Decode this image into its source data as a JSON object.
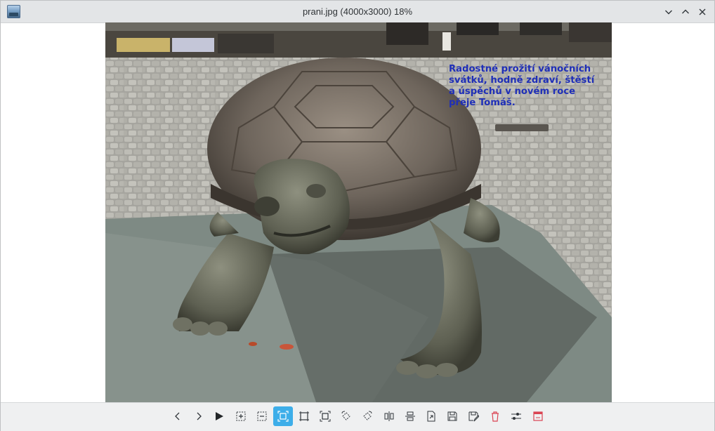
{
  "window": {
    "title": "prani.jpg (4000x3000) 18%",
    "icons": [
      "image-viewer-app-icon",
      "chevron-down-icon",
      "chevron-up-icon",
      "close-icon"
    ]
  },
  "image": {
    "caption": "Radostné prožití vánočních\nsvátků, hodně zdraví, štěstí\na úspěchů v novém roce\npřeje Tomáš.",
    "caption_color": "#1f2fb8"
  },
  "toolbar": {
    "accent": "#3daee9",
    "delete_color": "#da4453",
    "buttons": [
      {
        "icon": "previous-icon",
        "active": false
      },
      {
        "icon": "next-icon",
        "active": false
      },
      {
        "icon": "slideshow-play-icon",
        "active": false
      },
      {
        "icon": "zoom-in-icon",
        "active": false
      },
      {
        "icon": "zoom-out-icon",
        "active": false
      },
      {
        "icon": "zoom-fit-icon",
        "active": true
      },
      {
        "icon": "original-size-icon",
        "active": false
      },
      {
        "icon": "fit-width-icon",
        "active": false
      },
      {
        "icon": "rotate-left-icon",
        "active": false
      },
      {
        "icon": "rotate-right-icon",
        "active": false
      },
      {
        "icon": "flip-horizontal-icon",
        "active": false
      },
      {
        "icon": "flip-vertical-icon",
        "active": false
      },
      {
        "icon": "export-icon",
        "active": false
      },
      {
        "icon": "save-icon",
        "active": false
      },
      {
        "icon": "save-as-icon",
        "active": false
      },
      {
        "icon": "delete-icon",
        "active": false
      },
      {
        "icon": "settings-icon",
        "active": false
      },
      {
        "icon": "fullscreen-icon",
        "active": false
      }
    ]
  }
}
